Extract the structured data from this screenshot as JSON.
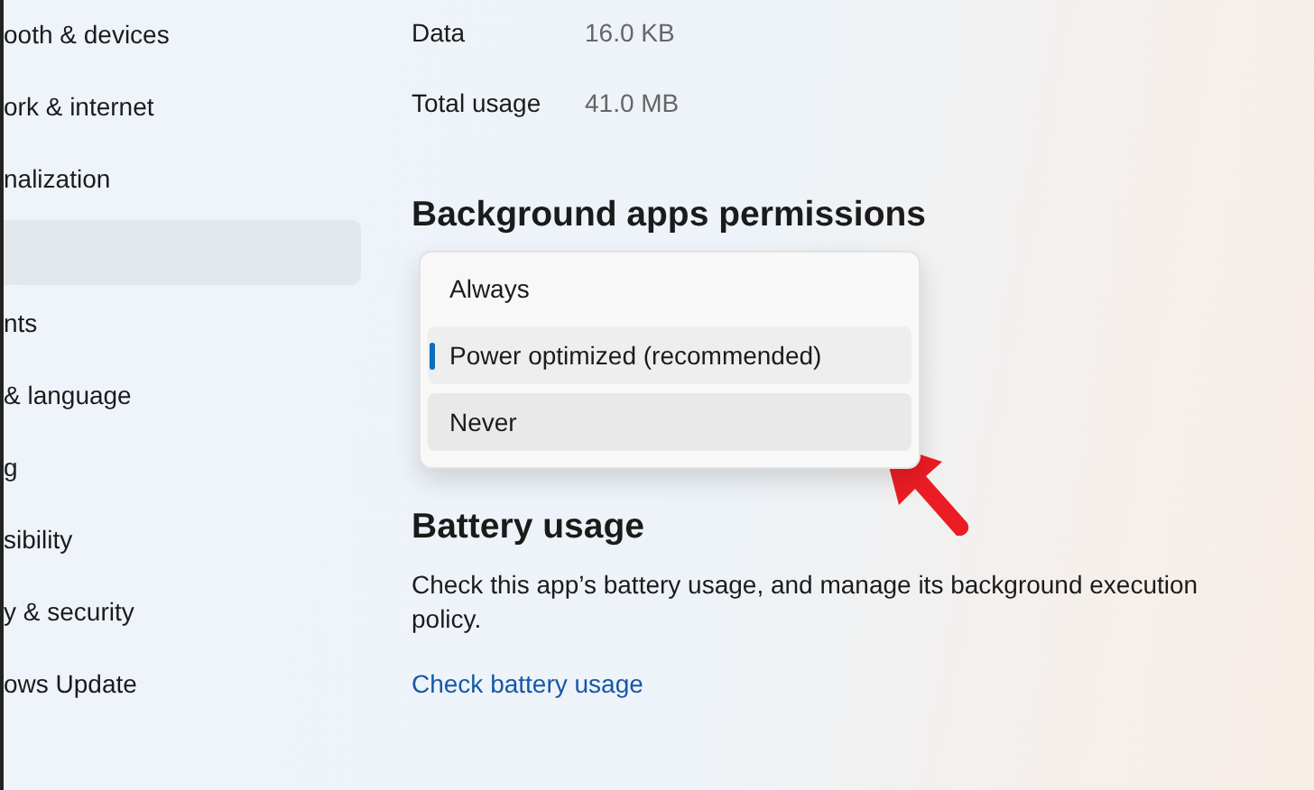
{
  "sidebar": {
    "items": [
      {
        "label": "ooth & devices",
        "selected": false
      },
      {
        "label": "ork & internet",
        "selected": false
      },
      {
        "label": "nalization",
        "selected": false
      },
      {
        "selected": true
      },
      {
        "label": "nts",
        "selected": false
      },
      {
        "label": "& language",
        "selected": false
      },
      {
        "label": "g",
        "selected": false
      },
      {
        "label": "sibility",
        "selected": false
      },
      {
        "label": "y & security",
        "selected": false
      },
      {
        "label": "ows Update",
        "selected": false
      }
    ]
  },
  "usage": [
    {
      "label": "Data",
      "value": "16.0 KB"
    },
    {
      "label": "Total usage",
      "value": "41.0 MB"
    }
  ],
  "permissions": {
    "title": "Background apps permissions",
    "options": [
      {
        "label": "Always",
        "selected": false,
        "hovered": false
      },
      {
        "label": "Power optimized (recommended)",
        "selected": true,
        "hovered": false
      },
      {
        "label": "Never",
        "selected": false,
        "hovered": true
      }
    ]
  },
  "battery": {
    "title": "Battery usage",
    "description": "Check this app’s battery usage, and manage its background execution policy.",
    "link": "Check battery usage"
  }
}
